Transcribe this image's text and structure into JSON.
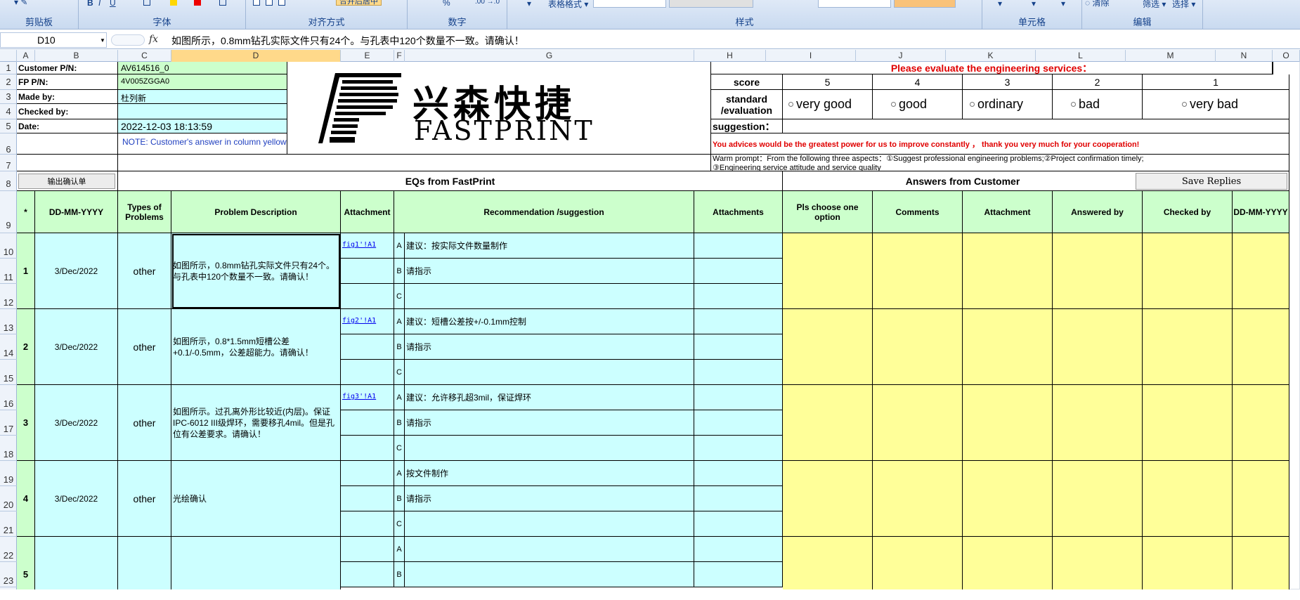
{
  "ribbon": {
    "groups": {
      "clipboard": "剪贴板",
      "font": "字体",
      "align": "对齐方式",
      "number": "数字",
      "styles": "样式",
      "cells": "单元格",
      "editing": "编辑"
    },
    "format_as_table": "表格格式",
    "sort_filter": "筛选",
    "find_select": "选择",
    "clear": "清除",
    "merge": "合并后居中",
    "percent": "%"
  },
  "formula_bar": {
    "name_box": "D10",
    "fx": "fx",
    "formula": "如图所示，0.8mm钻孔实际文件只有24个。与孔表中120个数量不一致。请确认！"
  },
  "columns": [
    "A",
    "B",
    "C",
    "D",
    "E",
    "F",
    "G",
    "H",
    "I",
    "J",
    "K",
    "L",
    "M",
    "N",
    "O"
  ],
  "rows": [
    "1",
    "2",
    "3",
    "4",
    "5",
    "6",
    "7",
    "8",
    "9",
    "10",
    "11",
    "12",
    "13",
    "14",
    "15",
    "16",
    "17",
    "18",
    "19",
    "20",
    "21",
    "22",
    "23"
  ],
  "header": {
    "customer_pn_label": "Customer P/N:",
    "customer_pn": "AV614516_0",
    "fp_pn_label": "FP P/N:",
    "fp_pn": "4V005ZGGA0",
    "made_by_label": "Made by:",
    "made_by": "杜列新",
    "checked_by_label": "Checked by:",
    "date_label": "Date:",
    "date": "2022-12-03 18:13:59",
    "note": "NOTE: Customer's  answer in column yellow area",
    "logo_cn": "兴森快捷",
    "logo_en": "FASTPRINT"
  },
  "evaluation": {
    "title": "Please evaluate the engineering services：",
    "score_label": "score",
    "scores": [
      "5",
      "4",
      "3",
      "2",
      "1"
    ],
    "standard_label": "standard /evaluation",
    "options": [
      "very good",
      "good",
      "ordinary",
      "bad",
      "very bad"
    ],
    "suggestion_label": "suggestion：",
    "advice": "You advices would be the greatest power for us to improve constantly ，  thank you very much for your cooperation!",
    "prompt1": "Warm prompt：From the following three aspects：①Suggest professional engineering problems;②Project confirmation timely;",
    "prompt2": "③Engineering service attitude and service quality"
  },
  "section": {
    "output_button": "输出确认单",
    "eqs_title": "EQs from FastPrint",
    "answers_title": "Answers from Customer",
    "save_button": "Save Replies"
  },
  "table_headers": {
    "no": "*",
    "date": "DD-MM-YYYY",
    "types": "Types of Problems",
    "desc": "Problem Description",
    "attachment": "Attachment",
    "recommend": "Recommendation /suggestion",
    "attachments": "Attachments",
    "choose": "Pls choose one option",
    "comments": "Comments",
    "cust_attachment": "Attachment",
    "answered_by": "Answered by",
    "checked_by": "Checked by",
    "cust_date": "DD-MM-YYYY"
  },
  "eqs": [
    {
      "no": "1",
      "date": "3/Dec/2022",
      "type": "other",
      "desc": "如图所示，0.8mm钻孔实际文件只有24个。与孔表中120个数量不一致。请确认！",
      "link": "fig1'!A1",
      "options": [
        {
          "letter": "A",
          "text": "建议：按实际文件数量制作"
        },
        {
          "letter": "B",
          "text": "请指示"
        },
        {
          "letter": "C",
          "text": ""
        }
      ]
    },
    {
      "no": "2",
      "date": "3/Dec/2022",
      "type": "other",
      "desc": "如图所示，0.8*1.5mm短槽公差+0.1/-0.5mm，公差超能力。请确认！",
      "link": "fig2'!A1",
      "options": [
        {
          "letter": "A",
          "text": "建议：短槽公差按+/-0.1mm控制"
        },
        {
          "letter": "B",
          "text": "请指示"
        },
        {
          "letter": "C",
          "text": ""
        }
      ]
    },
    {
      "no": "3",
      "date": "3/Dec/2022",
      "type": "other",
      "desc": "如图所示。过孔离外形比较近(内层)。保证IPC-6012 III级焊环，需要移孔4mil。但是孔位有公差要求。请确认！",
      "link": "fig3'!A1",
      "options": [
        {
          "letter": "A",
          "text": "建议：允许移孔超3mil，保证焊环"
        },
        {
          "letter": "B",
          "text": "请指示"
        },
        {
          "letter": "C",
          "text": ""
        }
      ]
    },
    {
      "no": "4",
      "date": "3/Dec/2022",
      "type": "other",
      "desc": "光绘确认",
      "link": "",
      "options": [
        {
          "letter": "A",
          "text": "按文件制作"
        },
        {
          "letter": "B",
          "text": "请指示"
        },
        {
          "letter": "C",
          "text": ""
        }
      ]
    },
    {
      "no": "5",
      "date": "",
      "type": "",
      "desc": "",
      "link": "",
      "options": [
        {
          "letter": "A",
          "text": ""
        },
        {
          "letter": "B",
          "text": ""
        }
      ]
    }
  ]
}
